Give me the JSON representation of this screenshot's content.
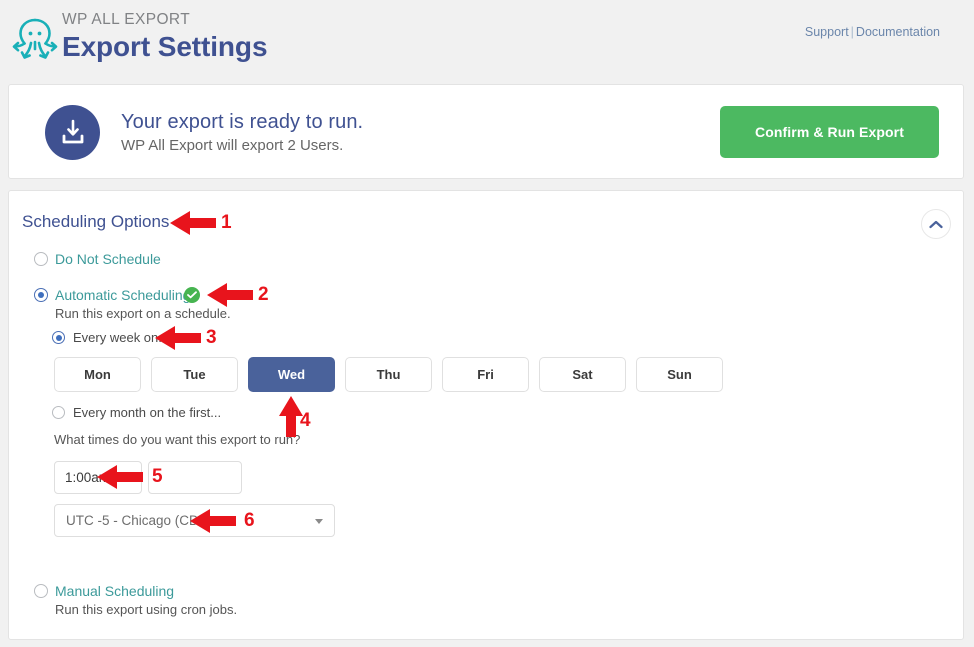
{
  "header": {
    "brand_kicker": "WP ALL EXPORT",
    "brand_title": "Export Settings",
    "logo_icon": "octopus-logo-icon",
    "support_label": "Support",
    "separator": "|",
    "documentation_label": "Documentation"
  },
  "ready_banner": {
    "icon": "download-icon",
    "title": "Your export is ready to run.",
    "subtitle": "WP All Export will export 2 Users.",
    "run_button_label": "Confirm & Run Export",
    "accent_green": "#4cb961",
    "accent_blue": "#3f5191"
  },
  "scheduling": {
    "section_title": "Scheduling Options",
    "collapse_icon": "chevron-up-icon",
    "options": [
      {
        "label": "Do Not Schedule",
        "selected": false,
        "description": ""
      },
      {
        "label": "Automatic Scheduling",
        "selected": true,
        "description": "Run this export on a schedule.",
        "badge_icon": "check-circle-icon"
      },
      {
        "label": "Manual Scheduling",
        "selected": false,
        "description": "Run this export using cron jobs."
      }
    ],
    "frequency": [
      {
        "label": "Every week on...",
        "selected": true
      },
      {
        "label": "Every month on the first...",
        "selected": false
      }
    ],
    "days": [
      {
        "label": "Mon",
        "active": false
      },
      {
        "label": "Tue",
        "active": false
      },
      {
        "label": "Wed",
        "active": true
      },
      {
        "label": "Thu",
        "active": false
      },
      {
        "label": "Fri",
        "active": false
      },
      {
        "label": "Sat",
        "active": false
      },
      {
        "label": "Sun",
        "active": false
      }
    ],
    "times_question": "What times do you want this export to run?",
    "time_value": "1:00am",
    "time_value_2": "",
    "timezone": "UTC -5 - Chicago (CDT)",
    "timezone_caret_icon": "chevron-down-icon"
  },
  "annotations": {
    "color": "#e8141c",
    "markers": [
      {
        "number": "1",
        "target": "Scheduling Options"
      },
      {
        "number": "2",
        "target": "Automatic Scheduling"
      },
      {
        "number": "3",
        "target": "Every week on..."
      },
      {
        "number": "4",
        "target": "Wed"
      },
      {
        "number": "5",
        "target": "1:00am"
      },
      {
        "number": "6",
        "target": "UTC -5 - Chicago (CDT)"
      }
    ]
  }
}
